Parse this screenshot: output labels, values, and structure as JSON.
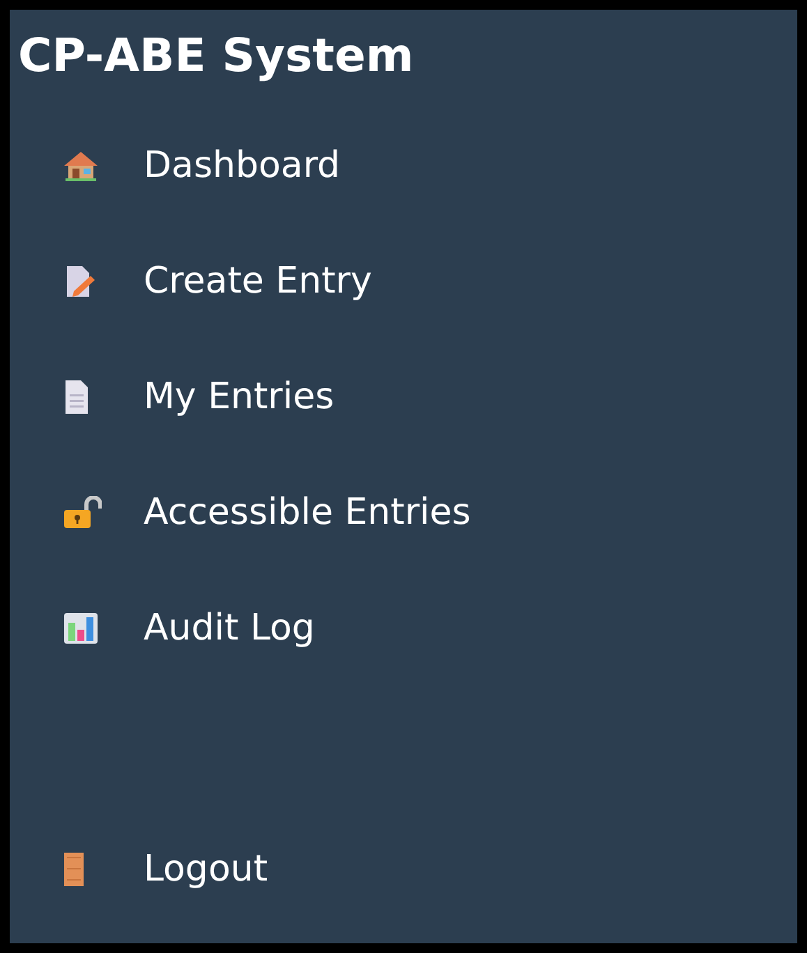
{
  "sidebar": {
    "title": "CP-ABE System",
    "items": [
      {
        "label": "Dashboard",
        "kind": "house"
      },
      {
        "label": "Create Entry",
        "kind": "edit"
      },
      {
        "label": "My Entries",
        "kind": "page"
      },
      {
        "label": "Accessible Entries",
        "kind": "unlock"
      },
      {
        "label": "Audit Log",
        "kind": "chart"
      }
    ],
    "footer_items": [
      {
        "label": "Logout",
        "kind": "door"
      }
    ]
  }
}
